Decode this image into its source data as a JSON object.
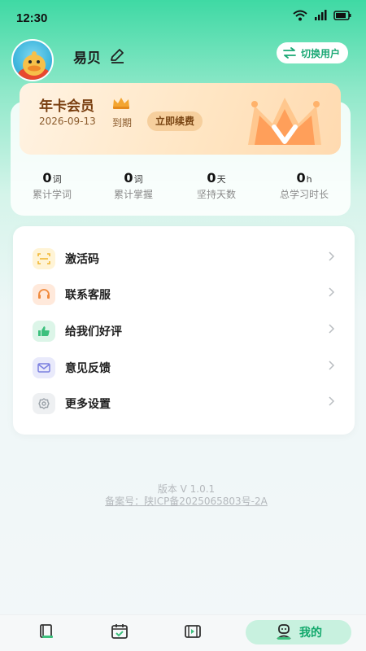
{
  "status_bar": {
    "time": "12:30"
  },
  "profile": {
    "name": "易贝",
    "switch_user_label": "切换用户"
  },
  "membership": {
    "title": "年卡会员",
    "expire_date": "2026-09-13",
    "expire_label": "到期",
    "renew_label": "立即续费"
  },
  "stats": [
    {
      "value": "0",
      "unit": "词",
      "label": "累计学词"
    },
    {
      "value": "0",
      "unit": "词",
      "label": "累计掌握"
    },
    {
      "value": "0",
      "unit": "天",
      "label": "坚持天数"
    },
    {
      "value": "0",
      "unit": "h",
      "label": "总学习时长"
    }
  ],
  "menu": [
    {
      "label": "激活码",
      "icon": "scan-code-icon",
      "color": "#f2b733"
    },
    {
      "label": "联系客服",
      "icon": "headset-icon",
      "color": "#f08a3c"
    },
    {
      "label": "给我们好评",
      "icon": "thumbs-up-icon",
      "color": "#3cc07d"
    },
    {
      "label": "意见反馈",
      "icon": "mail-icon",
      "color": "#7a7fe0"
    },
    {
      "label": "更多设置",
      "icon": "gear-icon",
      "color": "#9aa1a8"
    }
  ],
  "footer": {
    "version": "版本 V 1.0.1",
    "icp": "备案号：陕ICP备2025065803号-2A"
  },
  "bottom_nav": {
    "items": [
      "book-icon",
      "calendar-check-icon",
      "video-icon"
    ],
    "active_label": "我的",
    "accent": "#11a86b"
  }
}
